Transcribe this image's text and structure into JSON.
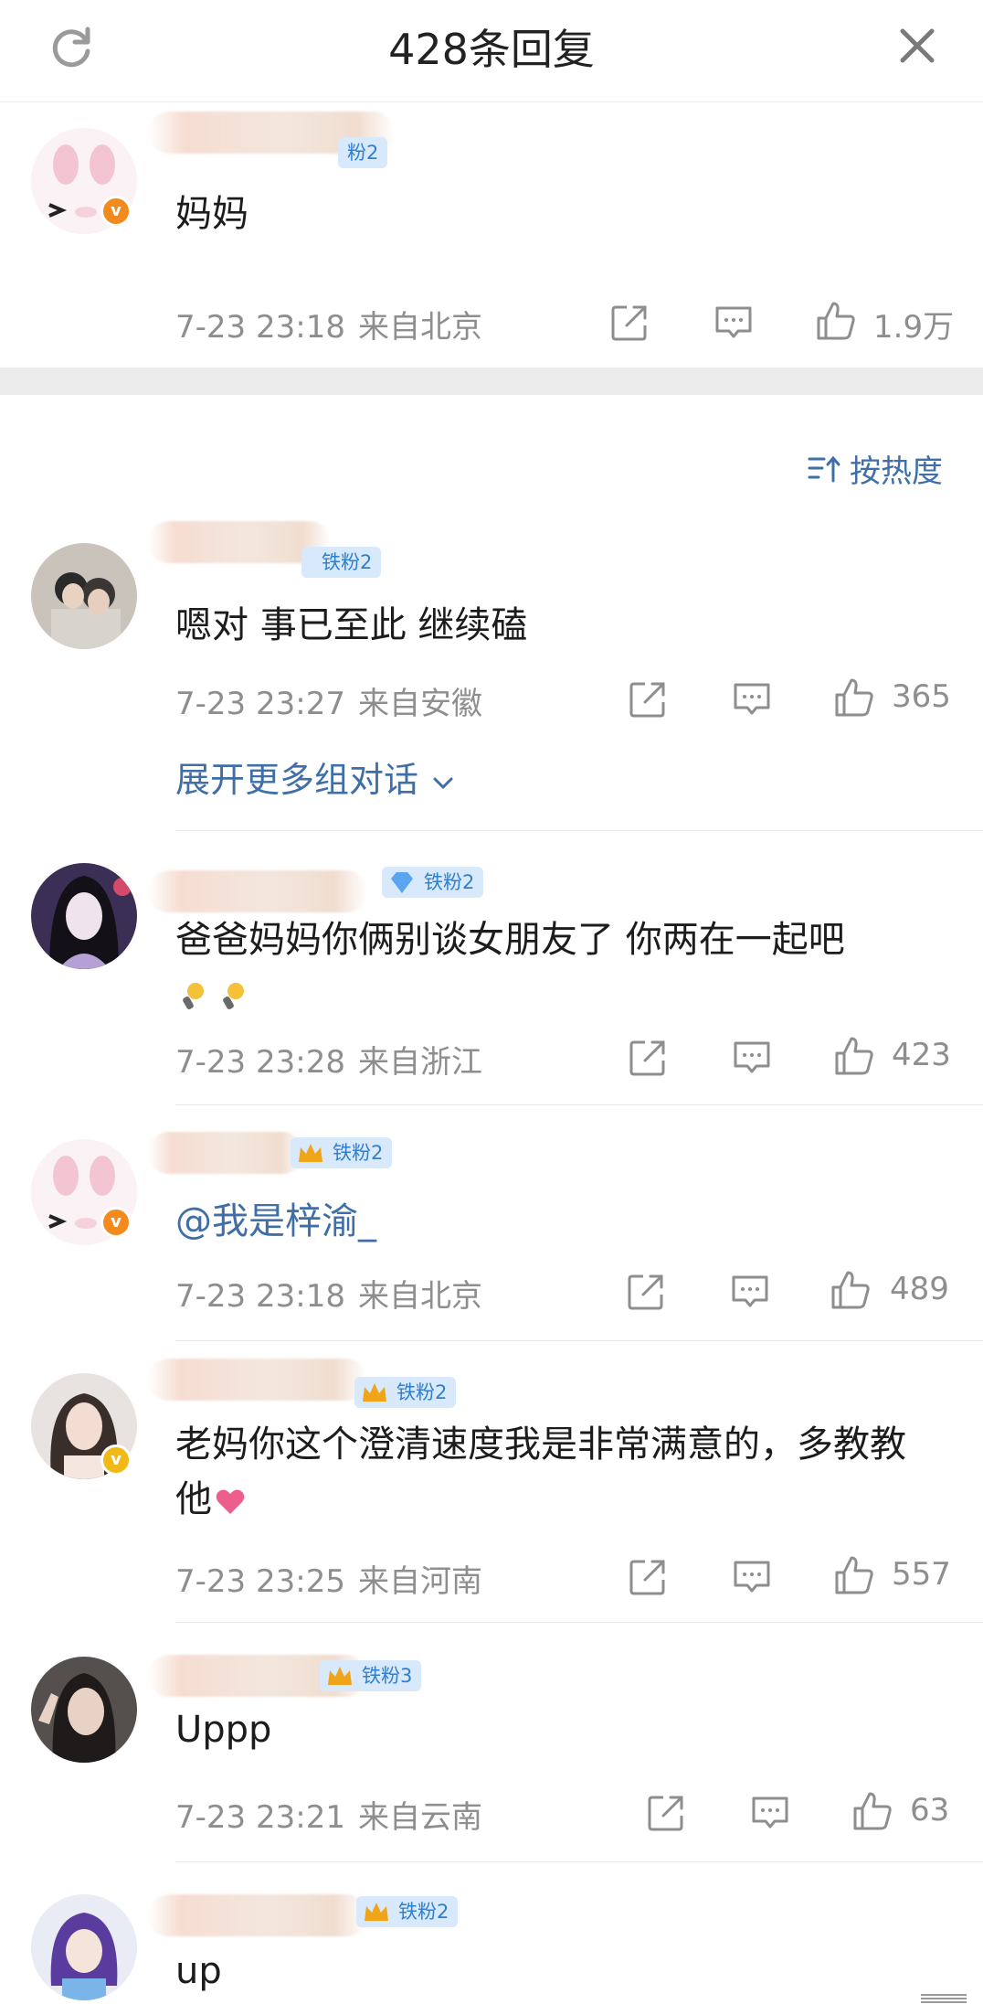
{
  "header": {
    "title": "428条回复",
    "refresh_icon": "refresh-icon",
    "close_icon": "close-icon"
  },
  "top_comment": {
    "text": "妈妈",
    "time": "7-23 23:18",
    "location": "来自北京",
    "likes": "1.9万",
    "badge": "粉2"
  },
  "sort": {
    "label": "按热度",
    "icon": "sort-icon"
  },
  "expand": {
    "label": "展开更多组对话"
  },
  "replies": [
    {
      "badge": "铁粉2",
      "text": "嗯对 事已至此 继续磕",
      "time": "7-23 23:27",
      "location": "来自安徽",
      "likes": "365"
    },
    {
      "badge": "铁粉2",
      "text": "爸爸妈妈你俩别谈女朋友了 你两在一起吧",
      "time": "7-23 23:28",
      "location": "来自浙江",
      "likes": "423"
    },
    {
      "badge": "铁粉2",
      "text": "@我是梓渝_",
      "time": "7-23 23:18",
      "location": "来自北京",
      "likes": "489"
    },
    {
      "badge": "铁粉2",
      "text": "老妈你这个澄清速度我是非常满意的，多教教他",
      "time": "7-23 23:25",
      "location": "来自河南",
      "likes": "557"
    },
    {
      "badge": "铁粉3",
      "text": "Uppp",
      "time": "7-23 23:21",
      "location": "来自云南",
      "likes": "63"
    },
    {
      "badge": "铁粉2",
      "text": "up"
    }
  ],
  "colors": {
    "link": "#3f6fa6",
    "meta": "#8e8e8e",
    "badge_bg": "#d7e9fb",
    "badge_text": "#2f7fd0",
    "verified_orange": "#f28a1d",
    "verified_gold": "#f0b915"
  }
}
